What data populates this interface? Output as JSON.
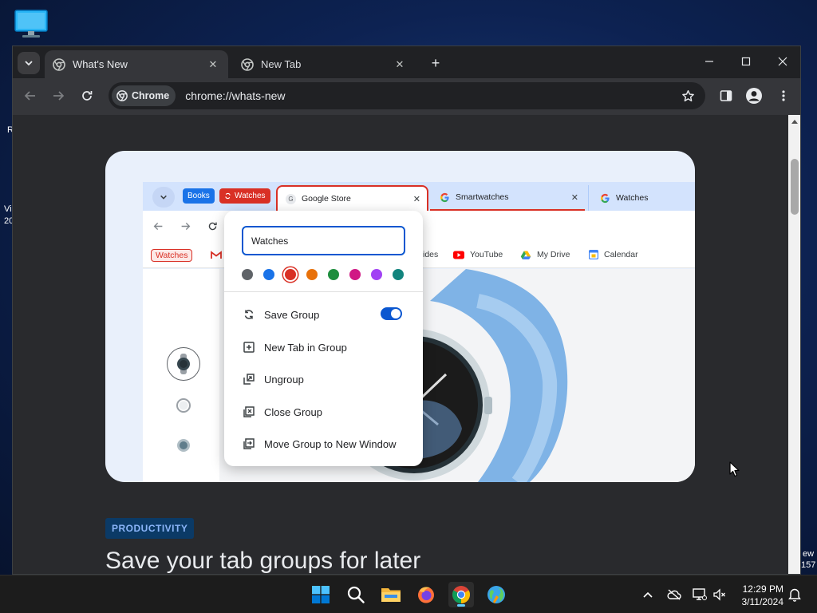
{
  "desktop": {
    "stub_texts": [
      "R",
      "Vi",
      "20",
      "ew",
      "157"
    ]
  },
  "browser": {
    "tabs": [
      {
        "label": "What's New",
        "active": true
      },
      {
        "label": "New Tab",
        "active": false
      }
    ],
    "omnibox": {
      "chip_label": "Chrome",
      "url": "chrome://whats-new"
    }
  },
  "hero": {
    "tab_groups": [
      {
        "label": "Books",
        "color": "#1a73e8"
      },
      {
        "label": "Watches",
        "color": "#d93025"
      }
    ],
    "mini_tabs": [
      "Google Store",
      "Smartwatches",
      "Watches"
    ],
    "bookmarks": {
      "group_chip": "Watches",
      "items": [
        "ides",
        "YouTube",
        "My Drive",
        "Calendar"
      ]
    },
    "popup": {
      "name_value": "Watches",
      "colors": [
        "#5f6368",
        "#1a73e8",
        "#d93025",
        "#e8710a",
        "#1e8e3e",
        "#d01884",
        "#a142f4",
        "#12847e"
      ],
      "selected_color": "#d93025",
      "menu": [
        {
          "label": "Save Group",
          "icon": "sync-icon",
          "toggle": true
        },
        {
          "label": "New Tab in Group",
          "icon": "add-box-icon"
        },
        {
          "label": "Ungroup",
          "icon": "ungroup-icon"
        },
        {
          "label": "Close Group",
          "icon": "close-box-icon"
        },
        {
          "label": "Move Group to New Window",
          "icon": "move-window-icon"
        }
      ]
    }
  },
  "article": {
    "category": "PRODUCTIVITY",
    "headline": "Save your tab groups for later"
  },
  "taskbar": {
    "apps": [
      "windows-start",
      "search",
      "file-explorer",
      "firefox",
      "chrome",
      "globe-app"
    ],
    "clock_time": "12:29 PM",
    "clock_date": "3/11/2024"
  }
}
